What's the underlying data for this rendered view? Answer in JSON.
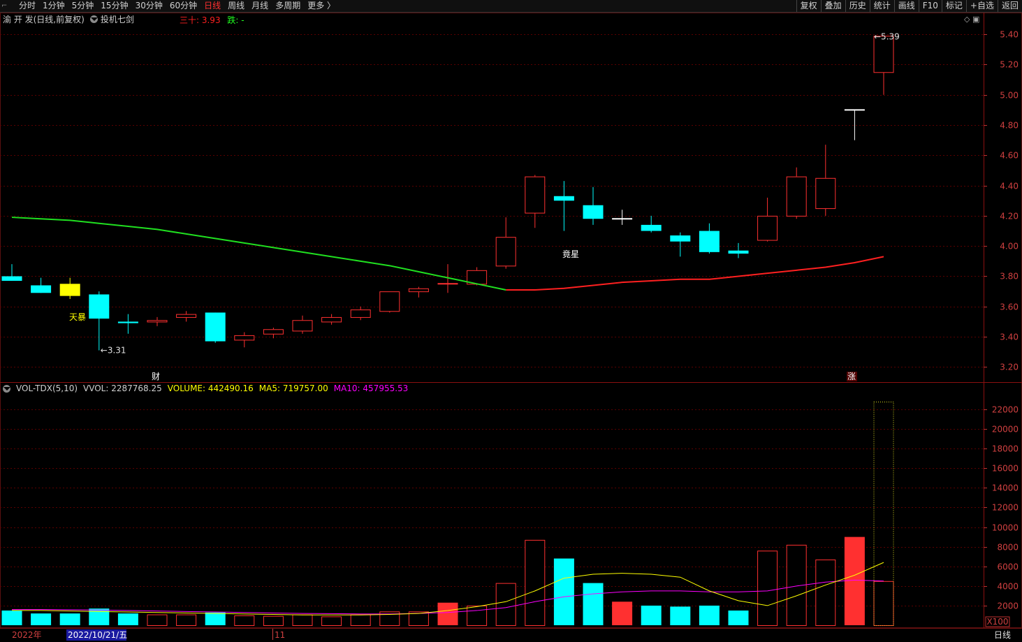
{
  "toolbar": {
    "left_items": [
      "分时",
      "1分钟",
      "5分钟",
      "15分钟",
      "30分钟",
      "60分钟",
      "日线",
      "周线",
      "月线",
      "多周期",
      "更多 〉"
    ],
    "active_item": "日线",
    "right_items": [
      "复权",
      "叠加",
      "历史",
      "统计",
      "画线",
      "F10",
      "标记",
      "+自选",
      "返回"
    ]
  },
  "title": {
    "stock": "渝 开 发(日线,前复权)",
    "indicator": "投机七剑",
    "ma30_label": "三十: 3.93",
    "fall_label": "跌: -"
  },
  "colors": {
    "up": "#ff3030",
    "down": "#00ffff",
    "grid": "#5a0000",
    "ma30_green": "#20e020",
    "ma30_red": "#ff2020",
    "yellow": "#ffff00",
    "magenta": "#ff00ff"
  },
  "annotations": {
    "low_label": "3.31",
    "high_label": "5.39",
    "tianbao": "天暴",
    "jingxing": "竟星",
    "cai_marker": "财",
    "zhang_marker": "涨"
  },
  "volume_header": {
    "name": "VOL-TDX(5,10)",
    "vvol": "VVOL: 2287768.25",
    "volume": "VOLUME: 442490.16",
    "ma5": "MA5: 719757.00",
    "ma10": "MA10: 457955.53"
  },
  "bottom": {
    "year": "2022年",
    "date": "2022/10/21/五",
    "month": "11",
    "period": "日线",
    "volume_unit": "X100"
  },
  "chart_data": {
    "type": "candlestick",
    "price_axis": {
      "ticks": [
        3.2,
        3.4,
        3.6,
        3.8,
        4.0,
        4.2,
        4.4,
        4.6,
        4.8,
        5.0,
        5.2,
        5.4
      ],
      "range": [
        3.1,
        5.47
      ]
    },
    "volume_axis": {
      "ticks": [
        2000,
        4000,
        6000,
        8000,
        10000,
        12000,
        14000,
        16000,
        18000,
        20000,
        22000
      ],
      "range": [
        0,
        23500
      ],
      "unit": "X100"
    },
    "candles": [
      {
        "o": 3.8,
        "h": 3.88,
        "l": 3.77,
        "c": 3.77,
        "v": 1500
      },
      {
        "o": 3.74,
        "h": 3.79,
        "l": 3.69,
        "c": 3.69,
        "v": 1200
      },
      {
        "o": 3.75,
        "h": 3.79,
        "l": 3.65,
        "c": 3.67,
        "v": 1200,
        "color": "yellow"
      },
      {
        "o": 3.68,
        "h": 3.7,
        "l": 3.31,
        "c": 3.52,
        "v": 1700
      },
      {
        "o": 3.5,
        "h": 3.55,
        "l": 3.42,
        "c": 3.49,
        "v": 1200
      },
      {
        "o": 3.5,
        "h": 3.53,
        "l": 3.47,
        "c": 3.51,
        "v": 1100
      },
      {
        "o": 3.53,
        "h": 3.57,
        "l": 3.5,
        "c": 3.55,
        "v": 1100
      },
      {
        "o": 3.56,
        "h": 3.56,
        "l": 3.36,
        "c": 3.37,
        "v": 1300
      },
      {
        "o": 3.38,
        "h": 3.43,
        "l": 3.33,
        "c": 3.41,
        "v": 1000
      },
      {
        "o": 3.42,
        "h": 3.46,
        "l": 3.39,
        "c": 3.45,
        "v": 950
      },
      {
        "o": 3.44,
        "h": 3.54,
        "l": 3.42,
        "c": 3.51,
        "v": 1100
      },
      {
        "o": 3.5,
        "h": 3.55,
        "l": 3.48,
        "c": 3.53,
        "v": 900
      },
      {
        "o": 3.53,
        "h": 3.6,
        "l": 3.51,
        "c": 3.58,
        "v": 1100
      },
      {
        "o": 3.57,
        "h": 3.7,
        "l": 3.56,
        "c": 3.7,
        "v": 1400
      },
      {
        "o": 3.7,
        "h": 3.73,
        "l": 3.66,
        "c": 3.72,
        "v": 1400
      },
      {
        "o": 3.75,
        "h": 3.88,
        "l": 3.69,
        "c": 3.75,
        "v": 2300
      },
      {
        "o": 3.75,
        "h": 3.86,
        "l": 3.74,
        "c": 3.84,
        "v": 2000
      },
      {
        "o": 3.87,
        "h": 4.19,
        "l": 3.85,
        "c": 4.06,
        "v": 4300
      },
      {
        "o": 4.22,
        "h": 4.47,
        "l": 4.12,
        "c": 4.46,
        "v": 8700
      },
      {
        "o": 4.33,
        "h": 4.43,
        "l": 4.1,
        "c": 4.3,
        "v": 6800
      },
      {
        "o": 4.27,
        "h": 4.39,
        "l": 4.14,
        "c": 4.18,
        "v": 4300
      },
      {
        "o": 4.18,
        "h": 4.24,
        "l": 4.14,
        "c": 4.18,
        "v": 2400
      },
      {
        "o": 4.14,
        "h": 4.2,
        "l": 4.09,
        "c": 4.1,
        "v": 2000
      },
      {
        "o": 4.07,
        "h": 4.09,
        "l": 3.93,
        "c": 4.03,
        "v": 1900
      },
      {
        "o": 4.1,
        "h": 4.15,
        "l": 3.95,
        "c": 3.96,
        "v": 2000
      },
      {
        "o": 3.97,
        "h": 4.02,
        "l": 3.92,
        "c": 3.95,
        "v": 1500
      },
      {
        "o": 4.04,
        "h": 4.32,
        "l": 4.03,
        "c": 4.2,
        "v": 7600
      },
      {
        "o": 4.2,
        "h": 4.52,
        "l": 4.18,
        "c": 4.46,
        "v": 8200
      },
      {
        "o": 4.25,
        "h": 4.67,
        "l": 4.2,
        "c": 4.45,
        "v": 6700
      },
      {
        "o": 4.9,
        "h": 4.9,
        "l": 4.7,
        "c": 4.9,
        "v": 9000
      },
      {
        "o": 5.15,
        "h": 5.39,
        "l": 5.0,
        "c": 5.39,
        "v": 4500
      }
    ],
    "last_volume_outline": 22800,
    "ma30_line": [
      4.19,
      4.18,
      4.17,
      4.15,
      4.13,
      4.11,
      4.08,
      4.05,
      4.02,
      3.99,
      3.96,
      3.93,
      3.9,
      3.87,
      3.83,
      3.79,
      3.75,
      3.71,
      3.71,
      3.72,
      3.74,
      3.76,
      3.77,
      3.78,
      3.78,
      3.8,
      3.82,
      3.84,
      3.86,
      3.89,
      3.93
    ],
    "vol_ma5": [
      1500,
      1500,
      1450,
      1400,
      1350,
      1300,
      1250,
      1200,
      1150,
      1100,
      1050,
      1050,
      1050,
      1100,
      1200,
      1500,
      1900,
      2400,
      3500,
      4800,
      5200,
      5300,
      5200,
      4900,
      3500,
      2500,
      2000,
      3000,
      4100,
      5100,
      6400,
      7100
    ],
    "vol_ma10": [
      1600,
      1600,
      1580,
      1550,
      1500,
      1450,
      1400,
      1350,
      1300,
      1250,
      1200,
      1180,
      1150,
      1150,
      1200,
      1300,
      1500,
      1800,
      2400,
      2900,
      3200,
      3400,
      3500,
      3500,
      3400,
      3400,
      3500,
      4000,
      4400,
      4600,
      4500,
      4450
    ]
  }
}
